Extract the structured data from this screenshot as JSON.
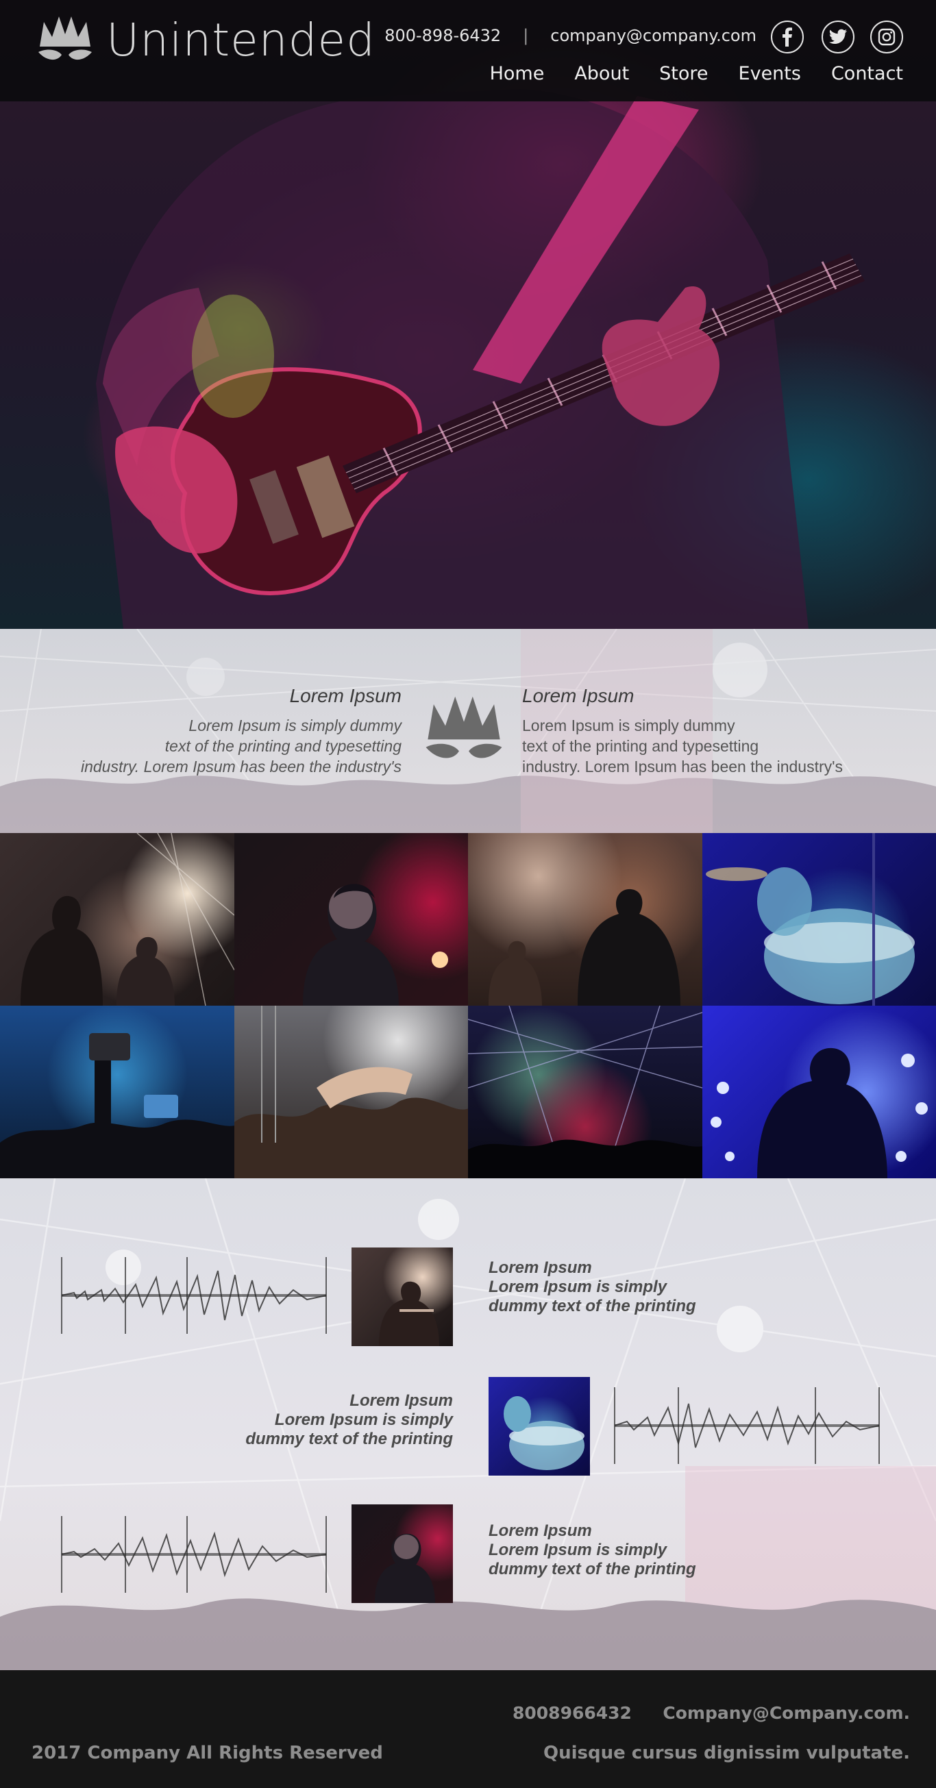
{
  "header": {
    "brand": "Unintended",
    "phone": "800-898-6432",
    "separator": "|",
    "email": "company@company.com",
    "social": [
      "facebook-icon",
      "twitter-icon",
      "instagram-icon"
    ],
    "nav": [
      "Home",
      "About",
      "Store",
      "Events",
      "Contact"
    ]
  },
  "intro": {
    "left": {
      "title": "Lorem Ipsum",
      "lines": [
        "Lorem Ipsum is simply dummy",
        "text of the printing and typesetting",
        "industry. Lorem Ipsum has been the industry's"
      ]
    },
    "right": {
      "title": "Lorem Ipsum",
      "lines": [
        "Lorem Ipsum is simply dummy",
        "text of the printing and typesetting",
        "industry. Lorem Ipsum has been the industry's"
      ]
    }
  },
  "gallery": [
    "concert-band-photo",
    "singer-photo",
    "smoky-stage-photo",
    "blue-drum-kit-photo",
    "crowd-phones-photo",
    "crowd-surfer-photo",
    "stage-lights-photo",
    "silhouette-blue-lights-photo"
  ],
  "tracks": [
    {
      "title": "Lorem Ipsum",
      "line1": "Lorem Ipsum is simply",
      "line2": "dummy text of the printing"
    },
    {
      "title": "Lorem Ipsum",
      "line1": "Lorem Ipsum is simply",
      "line2": "dummy text of the printing"
    },
    {
      "title": "Lorem Ipsum",
      "line1": "Lorem Ipsum is simply",
      "line2": "dummy text of the printing"
    }
  ],
  "footer": {
    "phone": "8008966432",
    "email": "Company@Company.com.",
    "copyright": "2017 Company All Rights Reserved",
    "tagline": "Quisque cursus dignissim vulputate."
  },
  "colors": {
    "header_bg": "#0c0c0e",
    "footer_bg": "#161616",
    "accent_pink": "#e0288c",
    "text_grey": "#555555"
  }
}
